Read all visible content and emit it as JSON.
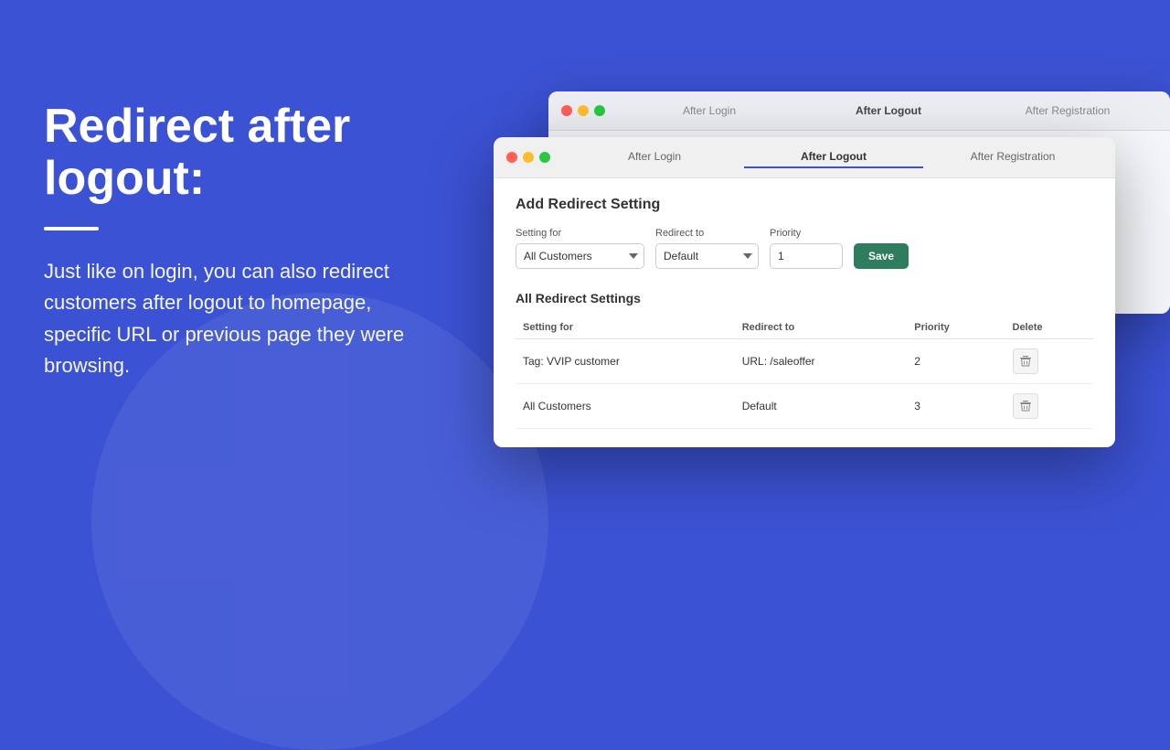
{
  "background": {
    "color": "#3b52d4"
  },
  "left": {
    "headline": "Redirect after logout:",
    "divider": true,
    "description": "Just like on login, you can also redirect customers after logout  to homepage, specific URL or previous page they were browsing."
  },
  "back_window": {
    "traffic_lights": [
      "red",
      "yellow",
      "green"
    ],
    "tabs": [
      {
        "label": "After Login",
        "active": false
      },
      {
        "label": "After Logout",
        "active": true
      },
      {
        "label": "After Registration",
        "active": false
      }
    ]
  },
  "front_window": {
    "traffic_lights": [
      "red",
      "yellow",
      "green"
    ],
    "tabs": [
      {
        "label": "After Login",
        "active": false
      },
      {
        "label": "After Logout",
        "active": true
      },
      {
        "label": "After Registration",
        "active": false
      }
    ],
    "add_redirect": {
      "title": "Add Redirect Setting",
      "setting_for_label": "Setting for",
      "setting_for_value": "All Customers",
      "redirect_to_label": "Redirect to",
      "redirect_to_value": "Default",
      "priority_label": "Priority",
      "priority_value": "1",
      "save_button": "Save"
    },
    "all_settings": {
      "title": "All Redirect Settings",
      "columns": [
        "Setting for",
        "Redirect to",
        "Priority",
        "Delete"
      ],
      "rows": [
        {
          "setting_for": "Tag: VVIP customer",
          "redirect_to": "URL: /saleoffer",
          "priority": "2"
        },
        {
          "setting_for": "All Customers",
          "redirect_to": "Default",
          "priority": "3"
        }
      ]
    }
  }
}
